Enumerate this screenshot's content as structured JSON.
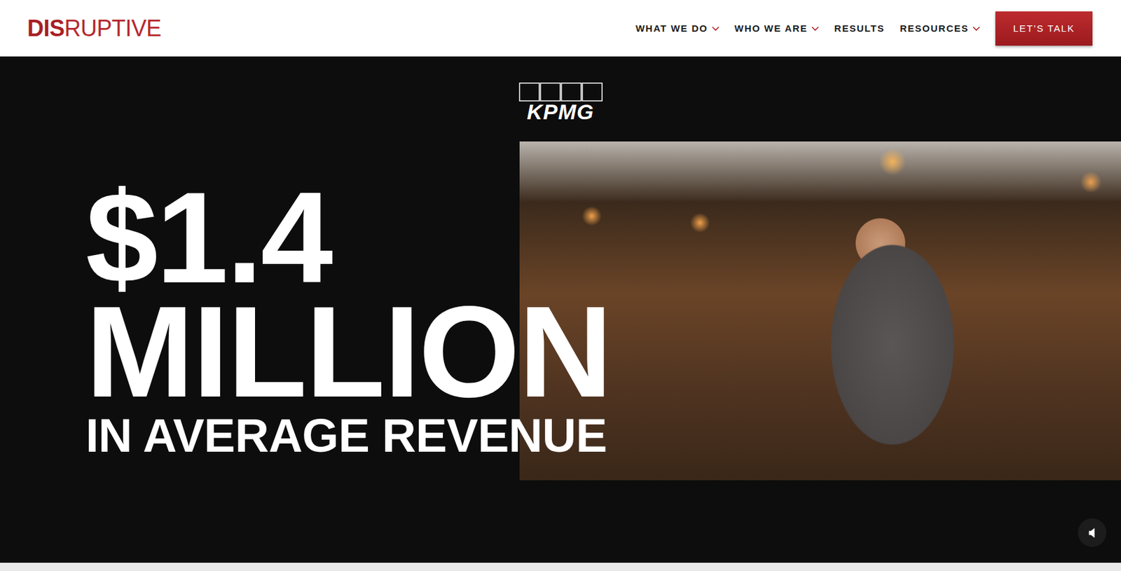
{
  "header": {
    "logo": {
      "bold": "DIS",
      "light": "RUPTIVE"
    },
    "nav": [
      {
        "label": "WHAT WE DO",
        "dropdown": true
      },
      {
        "label": "WHO WE ARE",
        "dropdown": true
      },
      {
        "label": "RESULTS",
        "dropdown": false
      },
      {
        "label": "RESOURCES",
        "dropdown": true
      }
    ],
    "cta": "LET’S TALK"
  },
  "hero": {
    "client_logo": "KPMG",
    "stat_value": "$1.4",
    "stat_unit": "MILLION",
    "caption": "IN AVERAGE REVENUE"
  },
  "sound_button": {
    "muted": true
  }
}
